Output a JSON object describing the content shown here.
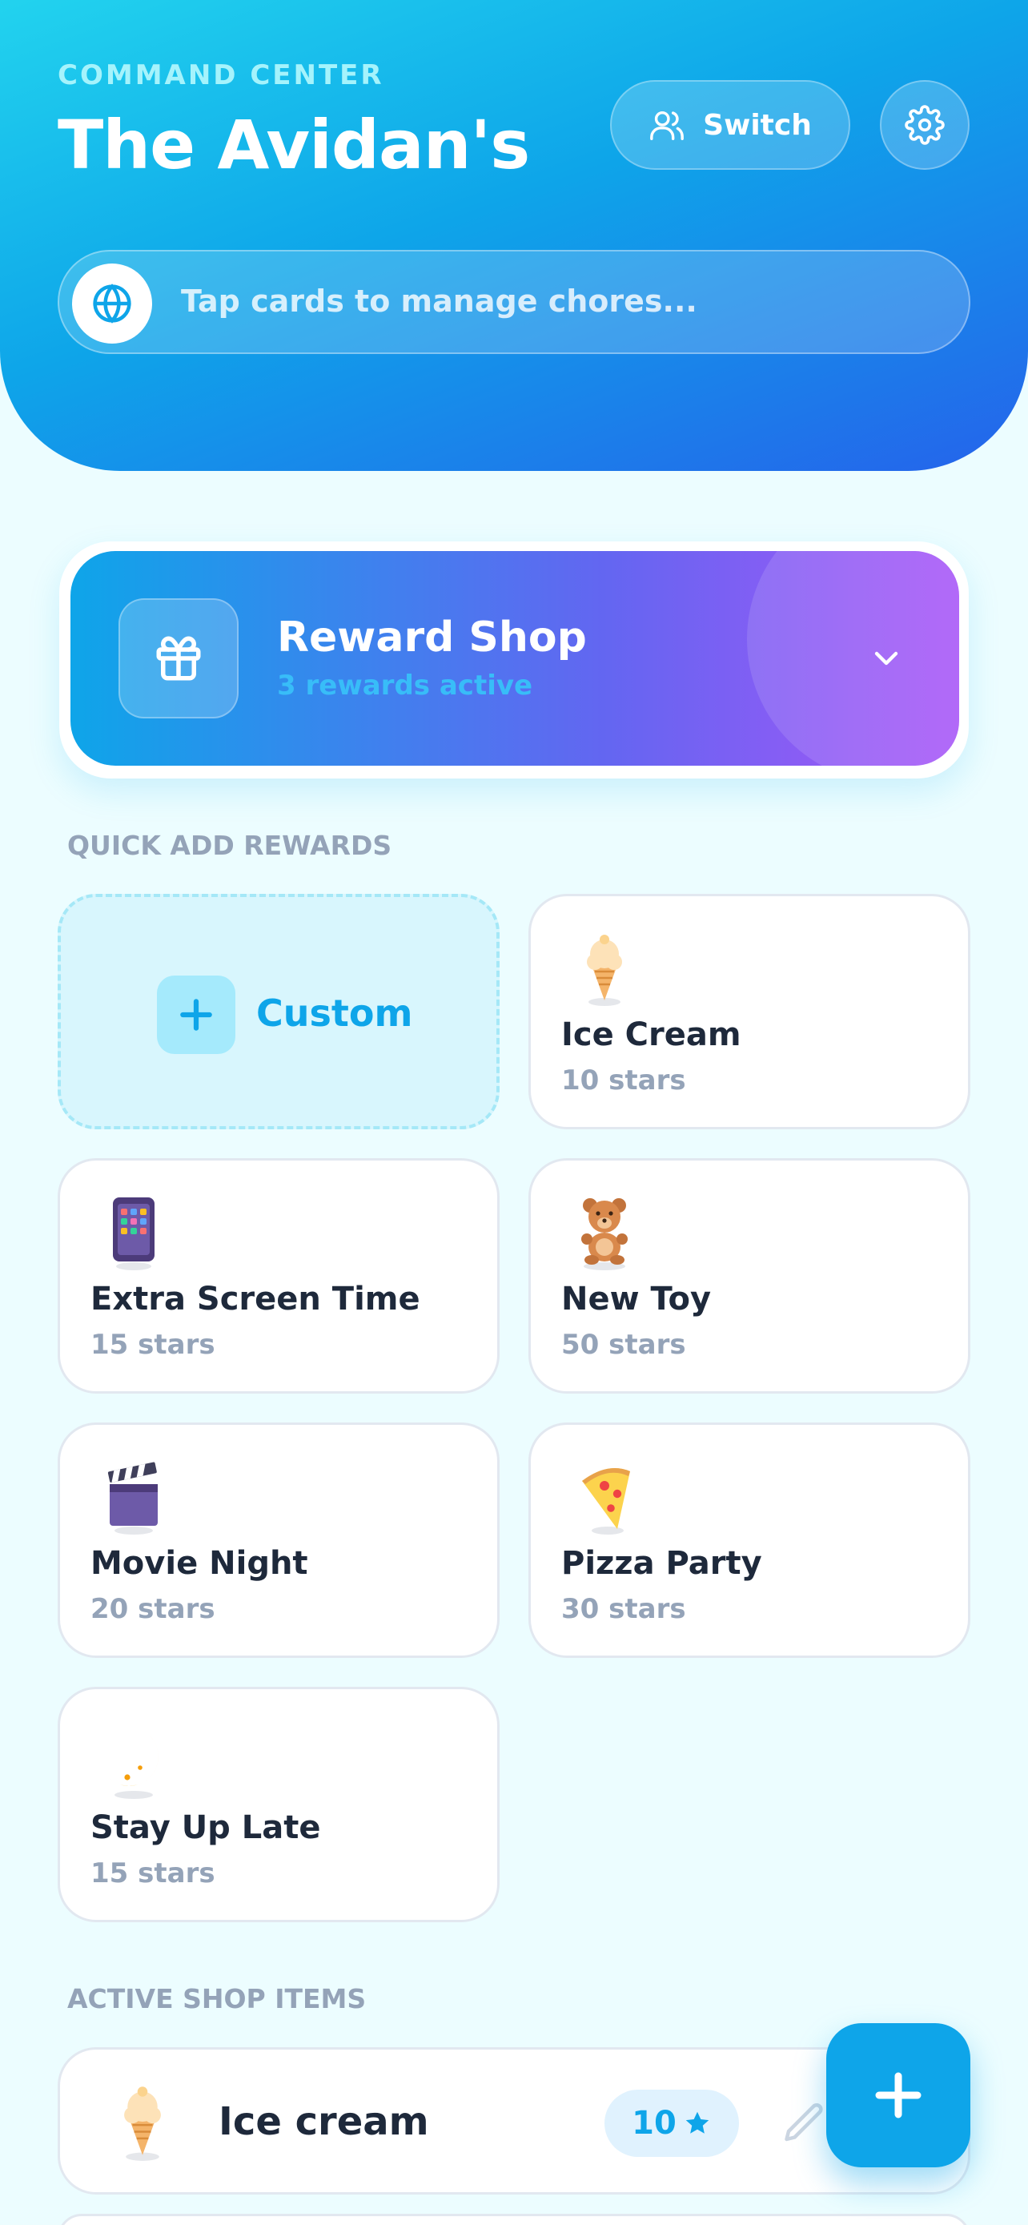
{
  "header": {
    "eyebrow": "COMMAND CENTER",
    "title": "The Avidan's",
    "switch_label": "Switch",
    "switch_icon": "users-icon",
    "settings_icon": "gear-icon",
    "search_placeholder": "Tap cards to manage chores...",
    "search_icon": "globe-icon"
  },
  "reward_shop": {
    "title": "Reward Shop",
    "subtitle": "3 rewards active",
    "icon": "gift-icon",
    "expanded": false
  },
  "quick_add": {
    "label": "QUICK ADD REWARDS",
    "custom_label": "Custom",
    "items": [
      {
        "name": "Ice Cream",
        "stars": "10 stars",
        "icon": "ice-cream-icon"
      },
      {
        "name": "Extra Screen Time",
        "stars": "15 stars",
        "icon": "tablet-icon"
      },
      {
        "name": "New Toy",
        "stars": "50 stars",
        "icon": "teddy-bear-icon"
      },
      {
        "name": "Movie Night",
        "stars": "20 stars",
        "icon": "clapper-board-icon"
      },
      {
        "name": "Pizza Party",
        "stars": "30 stars",
        "icon": "pizza-icon"
      },
      {
        "name": "Stay Up Late",
        "stars": "15 stars",
        "icon": "crescent-moon-icon"
      }
    ]
  },
  "active_items": {
    "label": "ACTIVE SHOP ITEMS",
    "items": [
      {
        "name": "Ice cream",
        "cost": "10",
        "icon": "ice-cream-icon"
      }
    ]
  },
  "colors": {
    "accent": "#0ea5e9",
    "header_start": "#22d3ee",
    "header_end": "#2563eb",
    "shop_end": "#a855f7",
    "background": "#ecfdff"
  }
}
